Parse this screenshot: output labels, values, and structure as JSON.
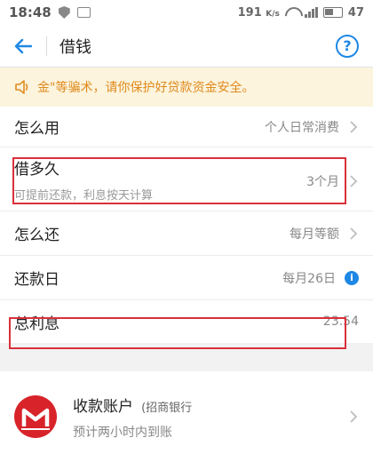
{
  "status_bar": {
    "time": "18:48",
    "speed": "191",
    "speed_unit": "K/s",
    "battery": "47"
  },
  "nav": {
    "title": "借钱",
    "help_label": "?"
  },
  "notice": {
    "text": "金\"等骗术，请你保护好贷款资金安全。"
  },
  "rows": {
    "usage": {
      "label": "怎么用",
      "value": "个人日常消费"
    },
    "duration": {
      "label": "借多久",
      "value": "3个月",
      "sub": "可提前还款，利息按天计算"
    },
    "repay_method": {
      "label": "怎么还",
      "value": "每月等额"
    },
    "repay_day": {
      "label": "还款日",
      "value": "每月26日",
      "info": "i"
    },
    "total_interest": {
      "label": "总利息",
      "value": "23.54"
    }
  },
  "account": {
    "title": "收款账户",
    "bank": "(招商银行",
    "sub": "预计两小时内到账"
  },
  "colors": {
    "accent": "#1e88e5",
    "notice_text": "#e08a1e",
    "notice_bg": "#fcf4dd",
    "highlight": "#d9303a",
    "bank_red": "#d8232a"
  }
}
